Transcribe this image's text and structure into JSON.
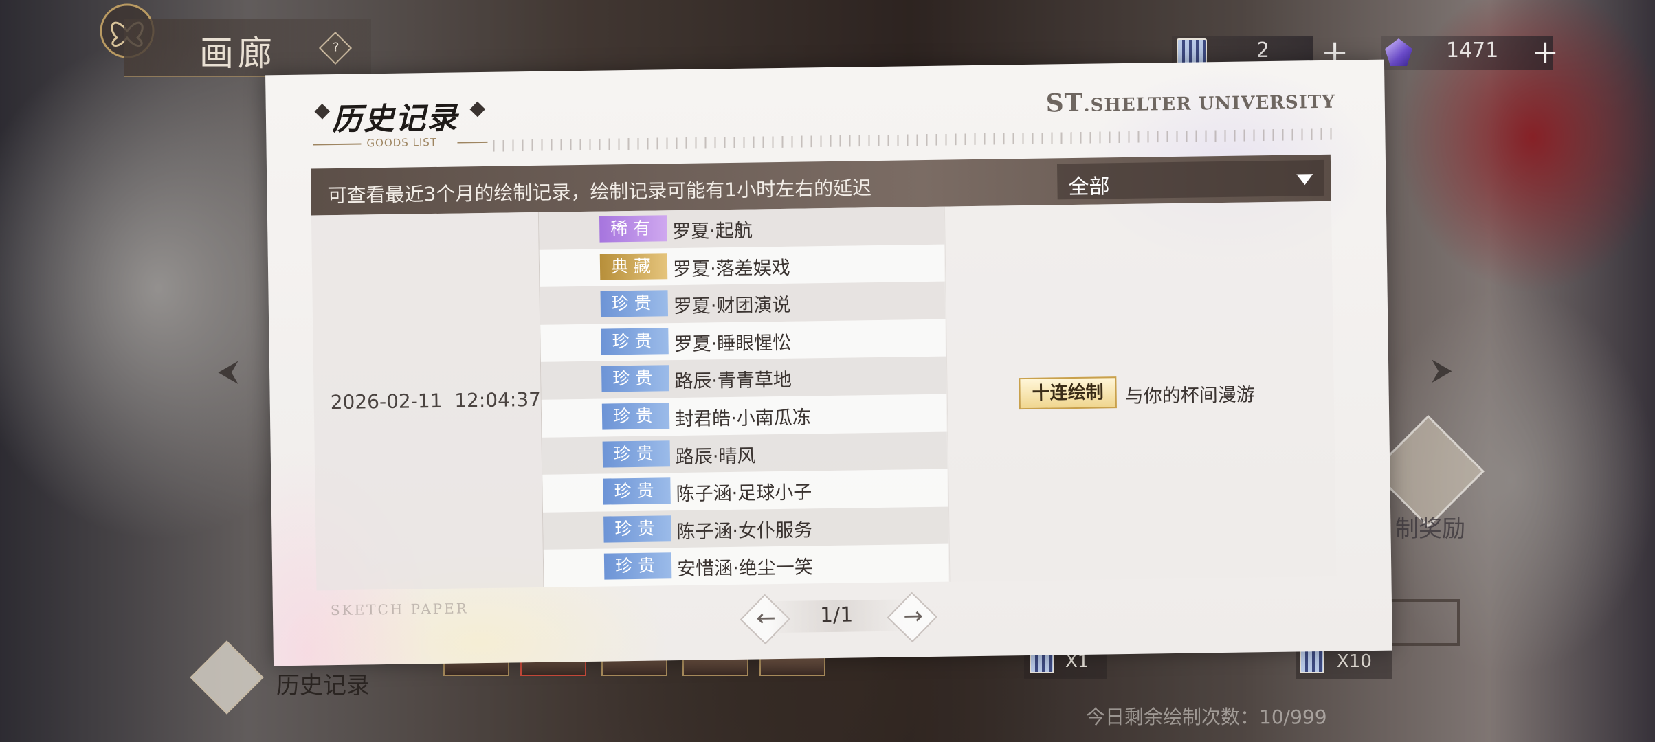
{
  "gallery": {
    "title": "画廊",
    "help_glyph": "?"
  },
  "currencies": [
    {
      "icon": "ticket-icon",
      "value": "2",
      "plus": "+"
    },
    {
      "icon": "gem-icon",
      "value": "1471",
      "plus": "+"
    }
  ],
  "modal": {
    "title": "历史记录",
    "subtitle": "GOODS LIST",
    "brand_main": "ST",
    "brand_rest": ".SHELTER UNIVERSITY",
    "info_text": "可查看最近3个月的绘制记录，绘制记录可能有1小时左右的延迟",
    "filter": {
      "selected": "全部"
    },
    "record": {
      "date": "2026-02-11  12:04:37",
      "type_badge": "十连绘制",
      "type_name": "与你的杯间漫游",
      "items": [
        {
          "rarity": "稀有",
          "color": "purple",
          "name": "罗夏·起航"
        },
        {
          "rarity": "典藏",
          "color": "gold",
          "name": "罗夏·落差娱戏"
        },
        {
          "rarity": "珍贵",
          "color": "blue",
          "name": "罗夏·财团演说"
        },
        {
          "rarity": "珍贵",
          "color": "blue",
          "name": "罗夏·睡眼惺忪"
        },
        {
          "rarity": "珍贵",
          "color": "blue",
          "name": "路辰·青青草地"
        },
        {
          "rarity": "珍贵",
          "color": "blue",
          "name": "封君皓·小南瓜冻"
        },
        {
          "rarity": "珍贵",
          "color": "blue",
          "name": "路辰·晴风"
        },
        {
          "rarity": "珍贵",
          "color": "blue",
          "name": "陈子涵·足球小子"
        },
        {
          "rarity": "珍贵",
          "color": "blue",
          "name": "陈子涵·女仆服务"
        },
        {
          "rarity": "珍贵",
          "color": "blue",
          "name": "安惜涵·绝尘一笑"
        }
      ]
    },
    "sketch_label": "SKETCH PAPER",
    "pager": {
      "text": "1/1"
    }
  },
  "bottom": {
    "history_label": "历史记录",
    "draw_x1": "X1",
    "draw_x10": "X10",
    "remaining": "今日剩余绘制次数：10/999",
    "reward_label": "制奖励"
  },
  "colors": {
    "tag_blue": "#7ea3df",
    "tag_purple": "#b98be6",
    "tag_gold": "#cfaa5a",
    "info_bar": "#6b5d56"
  }
}
